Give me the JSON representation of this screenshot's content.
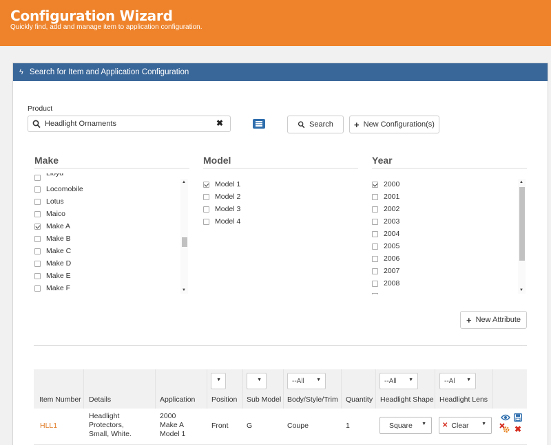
{
  "header": {
    "title": "Configuration Wizard",
    "subtitle": "Quickly find, add and manage item to application configuration."
  },
  "panel": {
    "title": "Search for Item and Application Configuration"
  },
  "search": {
    "label": "Product",
    "value": "Headlight Ornaments",
    "search_button": "Search",
    "new_config_button": "New Configuration(s)"
  },
  "make": {
    "title": "Make",
    "items": [
      {
        "label": "Lloyd",
        "checked": false
      },
      {
        "label": "Locomobile",
        "checked": false
      },
      {
        "label": "Lotus",
        "checked": false
      },
      {
        "label": "Maico",
        "checked": false
      },
      {
        "label": "Make A",
        "checked": true
      },
      {
        "label": "Make B",
        "checked": false
      },
      {
        "label": "Make C",
        "checked": false
      },
      {
        "label": "Make D",
        "checked": false
      },
      {
        "label": "Make E",
        "checked": false
      },
      {
        "label": "Make F",
        "checked": false
      }
    ]
  },
  "model": {
    "title": "Model",
    "items": [
      {
        "label": "Model 1",
        "checked": true
      },
      {
        "label": "Model 2",
        "checked": false
      },
      {
        "label": "Model 3",
        "checked": false
      },
      {
        "label": "Model 4",
        "checked": false
      }
    ]
  },
  "year": {
    "title": "Year",
    "items": [
      {
        "label": "2000",
        "checked": true
      },
      {
        "label": "2001",
        "checked": false
      },
      {
        "label": "2002",
        "checked": false
      },
      {
        "label": "2003",
        "checked": false
      },
      {
        "label": "2004",
        "checked": false
      },
      {
        "label": "2005",
        "checked": false
      },
      {
        "label": "2006",
        "checked": false
      },
      {
        "label": "2007",
        "checked": false
      },
      {
        "label": "2008",
        "checked": false
      }
    ]
  },
  "new_attribute_button": "New Attribute",
  "table": {
    "columns": {
      "item_number": "Item Number",
      "details": "Details",
      "application": "Application",
      "position": "Position",
      "sub_model": "Sub Model",
      "body": "Body/Style/Trim",
      "quantity": "Quantity",
      "headlight_shape": "Headlight Shape",
      "headlight_lens": "Headlight Lens"
    },
    "filters": {
      "body": "--All",
      "shape": "--All",
      "lens": "--Al"
    },
    "row": {
      "item_number": "HLL1",
      "details_1": "Headlight",
      "details_2": "Protectors,",
      "details_3": "Small, White.",
      "application_1": "2000",
      "application_2": "Make A",
      "application_3": "Model 1",
      "position": "Front",
      "sub_model": "G",
      "body": "Coupe",
      "quantity": "1",
      "shape": "Square",
      "lens": "Clear"
    }
  }
}
